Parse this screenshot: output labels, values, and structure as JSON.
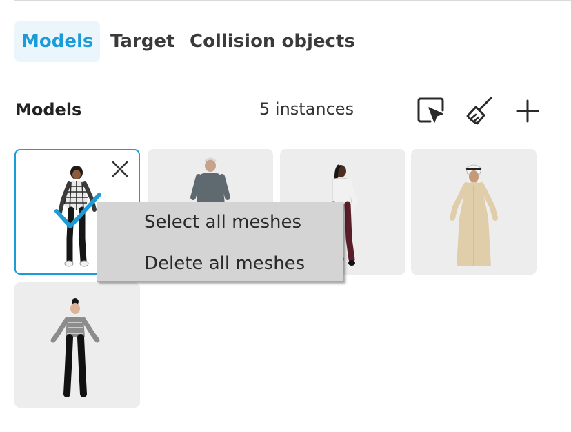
{
  "tabs": [
    {
      "label": "Models",
      "active": true
    },
    {
      "label": "Target",
      "active": false
    },
    {
      "label": "Collision objects",
      "active": false
    }
  ],
  "section": {
    "title": "Models",
    "instance_count": "5 instances"
  },
  "toolbar": {
    "select_icon": "select-cursor-icon",
    "clear_icon": "broom-icon",
    "add_icon": "plus-icon"
  },
  "models": [
    {
      "figure": "woman-plaid-shirt",
      "selected": true
    },
    {
      "figure": "older-man-grey-sweater",
      "selected": false
    },
    {
      "figure": "woman-white-blouse",
      "selected": false
    },
    {
      "figure": "man-thobe",
      "selected": false
    },
    {
      "figure": "woman-patterned-top",
      "selected": false
    }
  ],
  "context_menu": {
    "items": [
      "Select all meshes",
      "Delete all meshes"
    ]
  },
  "colors": {
    "accent": "#1b9bd7",
    "tab_active_bg": "#eaf5fc",
    "card_bg": "#ededed",
    "menu_bg": "#d4d4d4"
  }
}
